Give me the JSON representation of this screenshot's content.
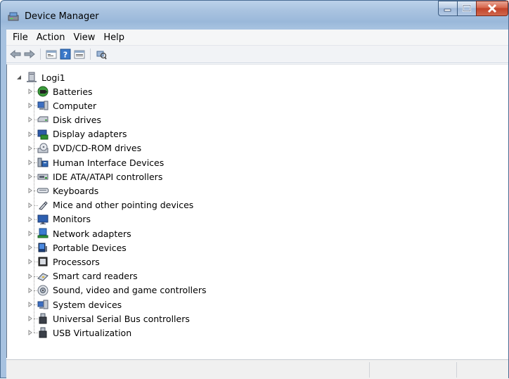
{
  "window": {
    "title": "Device Manager"
  },
  "menu": [
    "File",
    "Action",
    "View",
    "Help"
  ],
  "toolbar": [
    "back-arrow-icon",
    "forward-arrow-icon",
    "properties-icon",
    "help-icon",
    "view-icon",
    "scan-hardware-icon"
  ],
  "tree": {
    "root": "Logi1",
    "children": [
      {
        "label": "Batteries",
        "icon": "battery-icon"
      },
      {
        "label": "Computer",
        "icon": "computer-icon"
      },
      {
        "label": "Disk drives",
        "icon": "disk-drive-icon"
      },
      {
        "label": "Display adapters",
        "icon": "display-adapter-icon"
      },
      {
        "label": "DVD/CD-ROM drives",
        "icon": "dvd-drive-icon"
      },
      {
        "label": "Human Interface Devices",
        "icon": "hid-icon"
      },
      {
        "label": "IDE ATA/ATAPI controllers",
        "icon": "ide-controller-icon"
      },
      {
        "label": "Keyboards",
        "icon": "keyboard-icon"
      },
      {
        "label": "Mice and other pointing devices",
        "icon": "mouse-icon"
      },
      {
        "label": "Monitors",
        "icon": "monitor-icon"
      },
      {
        "label": "Network adapters",
        "icon": "network-adapter-icon"
      },
      {
        "label": "Portable Devices",
        "icon": "portable-device-icon"
      },
      {
        "label": "Processors",
        "icon": "processor-icon"
      },
      {
        "label": "Smart card readers",
        "icon": "smart-card-icon"
      },
      {
        "label": "Sound, video and game controllers",
        "icon": "sound-icon"
      },
      {
        "label": "System devices",
        "icon": "system-device-icon"
      },
      {
        "label": "Universal Serial Bus controllers",
        "icon": "usb-icon"
      },
      {
        "label": "USB Virtualization",
        "icon": "usb-icon"
      }
    ]
  },
  "status": {
    "text": ""
  }
}
